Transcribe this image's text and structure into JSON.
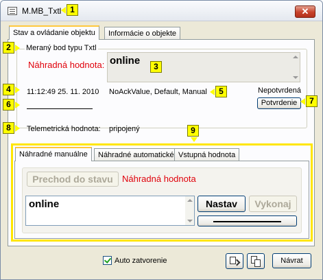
{
  "window": {
    "title": "M.MB_Txtl",
    "close_label": "✕"
  },
  "badges": [
    "1",
    "2",
    "3",
    "4",
    "5",
    "6",
    "7",
    "8",
    "9"
  ],
  "tabs": [
    {
      "label": "Stav a ovládanie objektu",
      "active": true
    },
    {
      "label": "Informácie o objekte",
      "active": false
    }
  ],
  "group": {
    "title": "Meraný bod typu Txtl"
  },
  "substitute": {
    "label": "Náhradná hodnota:",
    "value": "online"
  },
  "status_line": {
    "timestamp": "11:12:49 25. 11. 2010",
    "flags": "NoAckValue, Default, Manual",
    "ack_state": "Nepotvrdená",
    "confirm_button": "Potvrdenie"
  },
  "telemetry": {
    "label": "Telemetrická hodnota:",
    "value": "pripojený"
  },
  "inner_tabs": [
    {
      "label": "Náhradné manuálne",
      "active": true
    },
    {
      "label": "Náhradné automatické",
      "active": false
    },
    {
      "label": "Vstupná hodnota",
      "active": false
    }
  ],
  "manual": {
    "transition_button": "Prechod do stavu",
    "transition_label": "Náhradná hodnota",
    "value": "online",
    "set_button": "Nastav",
    "execute_button": "Vykonaj"
  },
  "footer": {
    "auto_close_label": "Auto zatvorenie",
    "auto_close_checked": true,
    "return_button": "Návrat"
  },
  "colors": {
    "accent_red": "#e0000a",
    "badge_yellow": "#ffff00",
    "group_border_yellow": "#ffe600"
  },
  "icons": [
    "app-window-icon",
    "close-icon",
    "copy-icon",
    "paste-icon",
    "checkmark-icon"
  ]
}
